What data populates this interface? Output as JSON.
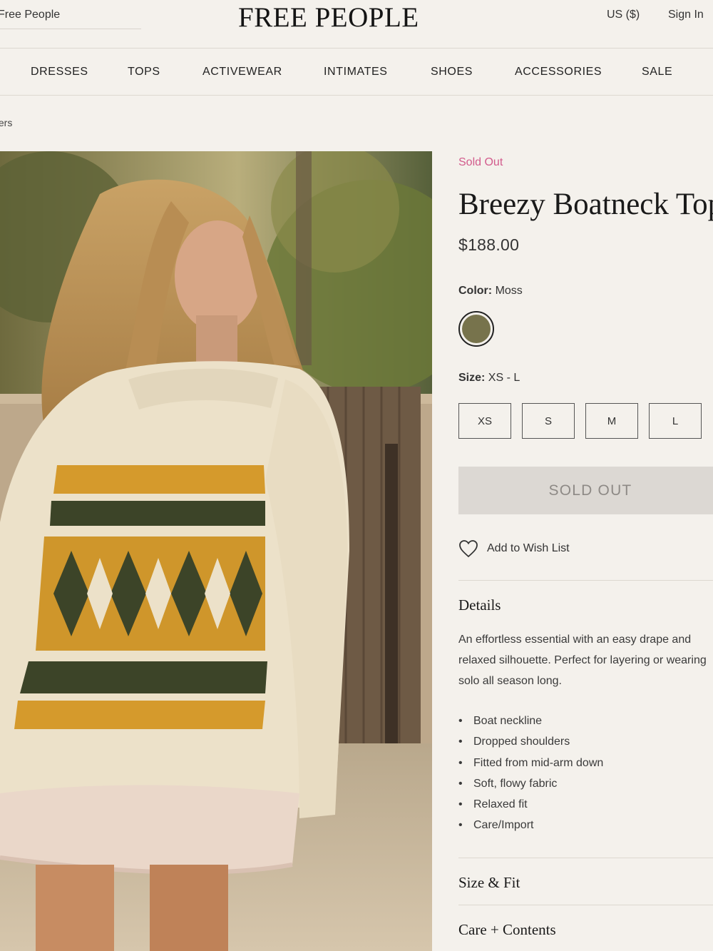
{
  "header": {
    "search_text": "Free People",
    "logo": "FREE PEOPLE",
    "currency": "US ($)",
    "sign_in": "Sign In"
  },
  "nav": [
    "DRESSES",
    "TOPS",
    "ACTIVEWEAR",
    "INTIMATES",
    "SHOES",
    "ACCESSORIES",
    "SALE"
  ],
  "breadcrumb": "ters",
  "product": {
    "status": "Sold Out",
    "title": "Breezy Boatneck Top",
    "price": "$188.00",
    "color_label": "Color:",
    "color_value": "Moss",
    "color_hex": "#77734c",
    "size_label": "Size:",
    "size_value": "XS - L",
    "sizes": [
      "XS",
      "S",
      "M",
      "L"
    ],
    "cta": "SOLD OUT",
    "wishlist": "Add to Wish List"
  },
  "details": {
    "title": "Details",
    "description": "An effortless essential with an easy drape and relaxed silhouette. Perfect for layering or wearing solo all season long.",
    "bullets": [
      "Boat neckline",
      "Dropped shoulders",
      "Fitted from mid-arm down",
      "Soft, flowy fabric",
      "Relaxed fit",
      "Care/Import"
    ]
  },
  "sections": {
    "size_fit": "Size & Fit",
    "care_contents": "Care + Contents"
  },
  "colors": {
    "accent_pink": "#d25b8c",
    "background": "#f4f1ec",
    "disabled_button": "#dcd8d3"
  }
}
